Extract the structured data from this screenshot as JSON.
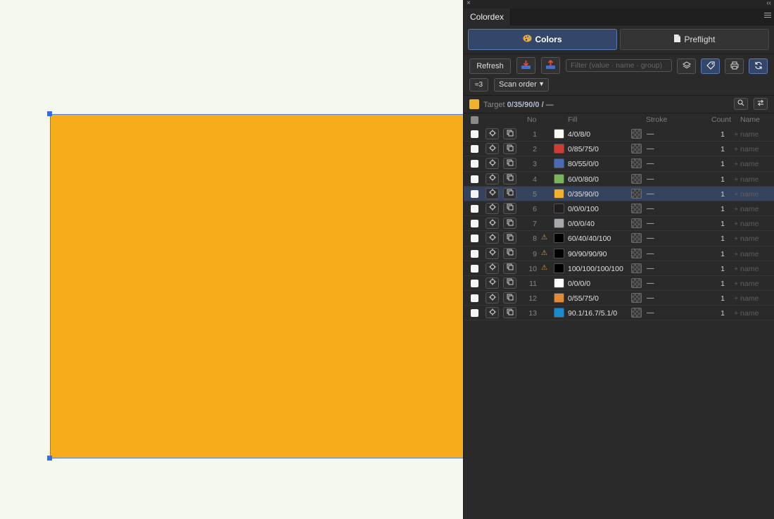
{
  "panel": {
    "close_glyph": "×",
    "collapse_glyph": "‹‹",
    "title": "Colordex",
    "tabs": {
      "colors": "Colors",
      "preflight": "Preflight"
    },
    "toolbar": {
      "refresh": "Refresh",
      "filter_placeholder": "Filter (value · name · group)",
      "approx": "≈3",
      "sort": "Scan order",
      "sort_options": [
        "Scan order"
      ]
    },
    "target": {
      "label": "Target",
      "value": "0/35/90/0 /",
      "stroke": "—",
      "color": "#f0b32b"
    },
    "columns": {
      "no": "No",
      "fill": "Fill",
      "stroke": "Stroke",
      "count": "Count",
      "name": "Name"
    },
    "rows": [
      {
        "no": "1",
        "fill": "4/0/8/0",
        "swatch": "#fbfaf1",
        "stroke": "—",
        "count": "1",
        "name": "+ name",
        "warn": ""
      },
      {
        "no": "2",
        "fill": "0/85/75/0",
        "swatch": "#d23b34",
        "stroke": "—",
        "count": "1",
        "name": "+ name",
        "warn": ""
      },
      {
        "no": "3",
        "fill": "80/55/0/0",
        "swatch": "#4a6ab5",
        "stroke": "—",
        "count": "1",
        "name": "+ name",
        "warn": ""
      },
      {
        "no": "4",
        "fill": "60/0/80/0",
        "swatch": "#7ab55b",
        "stroke": "—",
        "count": "1",
        "name": "+ name",
        "warn": ""
      },
      {
        "no": "5",
        "fill": "0/35/90/0",
        "swatch": "#f0b32b",
        "stroke": "—",
        "count": "1",
        "name": "+ name",
        "warn": "",
        "selected": true
      },
      {
        "no": "6",
        "fill": "0/0/0/100",
        "swatch": "#231f20",
        "stroke": "—",
        "count": "1",
        "name": "+ name",
        "warn": ""
      },
      {
        "no": "7",
        "fill": "0/0/0/40",
        "swatch": "#a7a9ac",
        "stroke": "—",
        "count": "1",
        "name": "+ name",
        "warn": ""
      },
      {
        "no": "8",
        "fill": "60/40/40/100",
        "swatch": "#000000",
        "stroke": "—",
        "count": "1",
        "name": "+ name",
        "warn": "⚠"
      },
      {
        "no": "9",
        "fill": "90/90/90/90",
        "swatch": "#000000",
        "stroke": "—",
        "count": "1",
        "name": "+ name",
        "warn": "⚠"
      },
      {
        "no": "10",
        "fill": "100/100/100/100",
        "swatch": "#000000",
        "stroke": "—",
        "count": "1",
        "name": "+ name",
        "warn": "⚠"
      },
      {
        "no": "11",
        "fill": "0/0/0/0",
        "swatch": "#ffffff",
        "stroke": "—",
        "count": "1",
        "name": "+ name",
        "warn": ""
      },
      {
        "no": "12",
        "fill": "0/55/75/0",
        "swatch": "#e08a3c",
        "stroke": "—",
        "count": "1",
        "name": "+ name",
        "warn": ""
      },
      {
        "no": "13",
        "fill": "90.1/16.7/5.1/0",
        "swatch": "#1b8bd1",
        "stroke": "—",
        "count": "1",
        "name": "+ name",
        "warn": ""
      }
    ]
  },
  "colors": {
    "artboard_fill": "#f7ac1b",
    "selection": "#2f6df5",
    "accent": "#34476a"
  }
}
